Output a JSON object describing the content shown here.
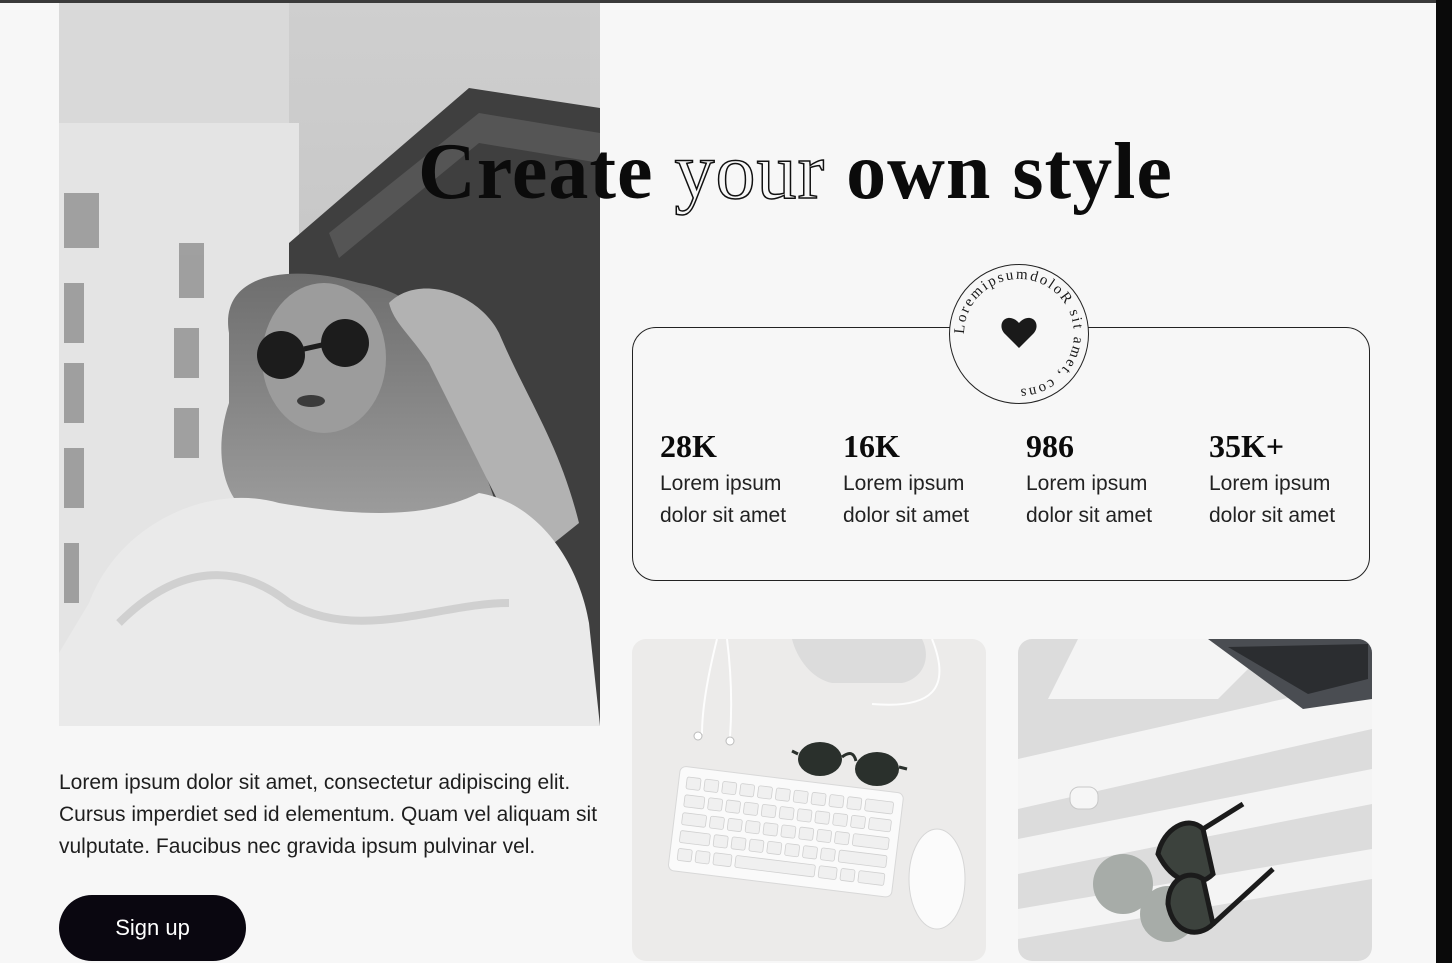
{
  "headline": {
    "word_1": "Create",
    "word_2": "your",
    "word_3": "own style"
  },
  "badge": {
    "circular_text": "LoremipsumdoloR sit amet, cons",
    "icon": "heart-icon"
  },
  "stats": [
    {
      "value": "28K",
      "label": "Lorem ipsum dolor sit amet"
    },
    {
      "value": "16K",
      "label": "Lorem ipsum dolor sit amet"
    },
    {
      "value": "986",
      "label": "Lorem ipsum dolor sit amet"
    },
    {
      "value": "35K+",
      "label": "Lorem ipsum dolor sit amet"
    }
  ],
  "description": "Lorem ipsum dolor sit amet, consectetur adipiscing elit. Cursus imperdiet sed id elementum. Quam vel aliquam sit vulputate. Faucibus nec gravida ipsum pulvinar vel.",
  "cta": {
    "label": "Sign up"
  },
  "colors": {
    "background": "#f7f7f7",
    "text": "#0b0b0b",
    "button": "#0a0710",
    "button_text": "#ffffff"
  }
}
